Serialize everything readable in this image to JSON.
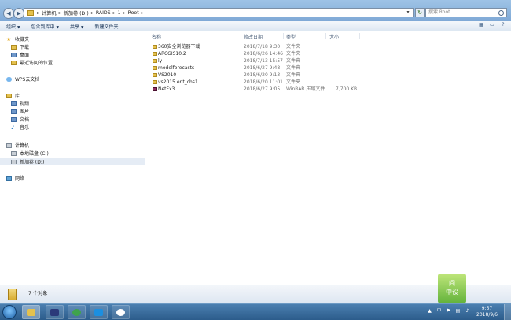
{
  "address": {
    "crumbs": [
      "计算机",
      "新加卷 (D:)",
      "RAIDS",
      "1",
      "Root"
    ],
    "search_placeholder": "搜索 Root"
  },
  "toolbar": {
    "organize": "组织",
    "include_library": "包含到库中",
    "share": "共享",
    "new_folder": "新建文件夹"
  },
  "sidebar": {
    "favorites": "收藏夹",
    "downloads": "下载",
    "desktop": "桌面",
    "recent": "最近访问的位置",
    "wps_cloud": "WPS云文档",
    "libraries": "库",
    "videos": "视频",
    "pictures": "图片",
    "documents": "文档",
    "music": "音乐",
    "computer": "计算机",
    "local_disk": "本地磁盘 (C:)",
    "new_volume": "新加卷 (D:)",
    "network": "网络"
  },
  "columns": {
    "name": "名称",
    "date": "修改日期",
    "type": "类型",
    "size": "大小"
  },
  "files": [
    {
      "name": "360安全浏览器下载",
      "date": "2018/7/18 9:30",
      "type": "文件夹",
      "size": "",
      "kind": "folder"
    },
    {
      "name": "ARCGIS10.2",
      "date": "2018/6/26 14:46",
      "type": "文件夹",
      "size": "",
      "kind": "folder"
    },
    {
      "name": "ly",
      "date": "2018/7/13 15:57",
      "type": "文件夹",
      "size": "",
      "kind": "folder"
    },
    {
      "name": "modelforecasts",
      "date": "2018/6/27 9:48",
      "type": "文件夹",
      "size": "",
      "kind": "folder"
    },
    {
      "name": "VS2010",
      "date": "2018/6/20 9:13",
      "type": "文件夹",
      "size": "",
      "kind": "folder"
    },
    {
      "name": "vs2015.ent_chs1",
      "date": "2018/6/20 11:01",
      "type": "文件夹",
      "size": "",
      "kind": "folder"
    },
    {
      "name": "NetFx3",
      "date": "2018/6/27 9:05",
      "type": "WinRAR 压缩文件",
      "size": "7,700 KB",
      "kind": "rar"
    }
  ],
  "status": {
    "item_count": "7 个对象"
  },
  "taskbar": {
    "time": "9:57",
    "date": "2018/9/6",
    "apps": [
      "explorer-icon",
      "hex-icon",
      "browser-icon",
      "s-app-icon",
      "baidu-cloud-icon"
    ]
  }
}
